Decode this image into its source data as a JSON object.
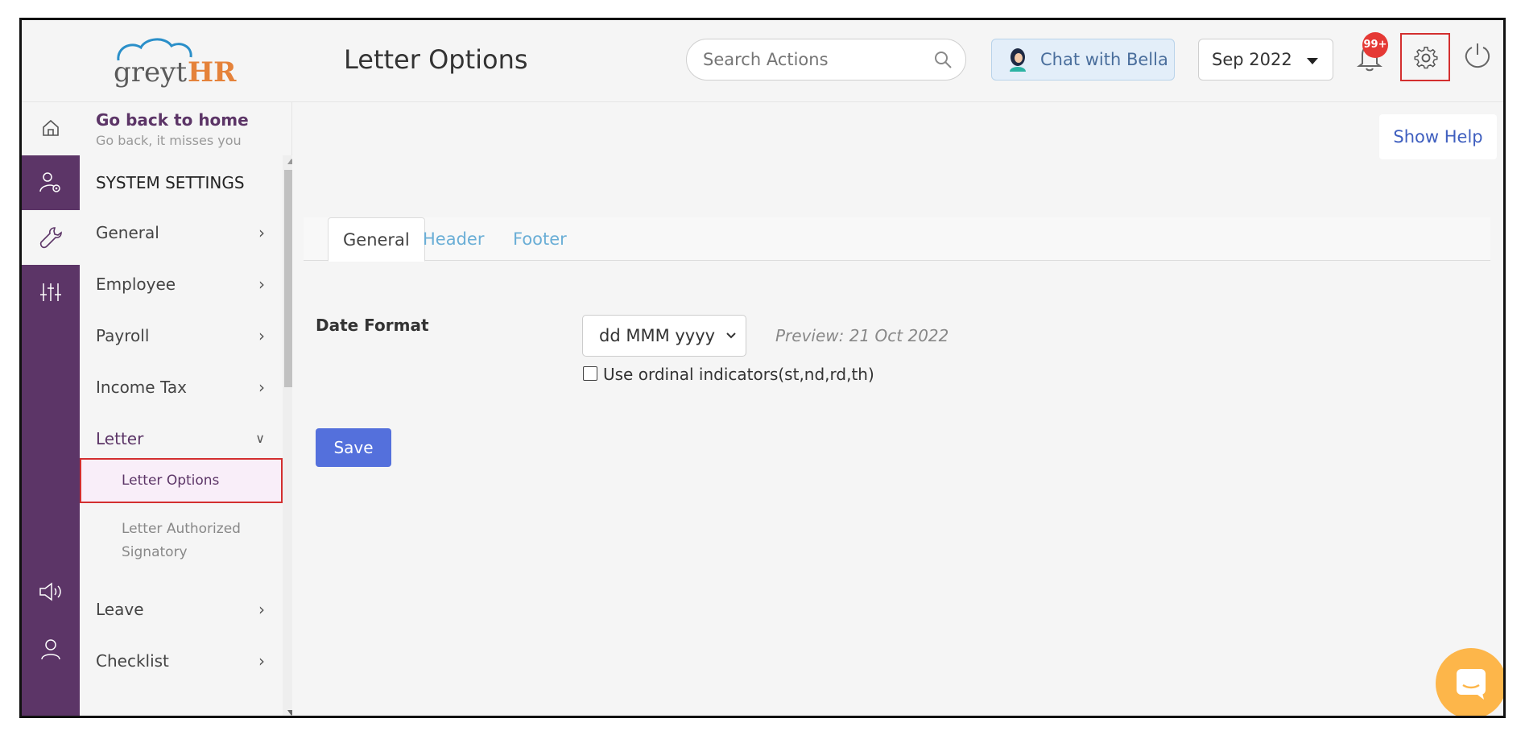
{
  "app": {
    "logo_text_1": "greyt",
    "logo_text_2": "HR",
    "page_title": "Letter Options"
  },
  "header": {
    "search_placeholder": "Search Actions",
    "chat_label": "Chat with Bella",
    "month_value": "Sep 2022",
    "notification_badge": "99+"
  },
  "sidebar": {
    "go_back_title": "Go back to home",
    "go_back_subtitle": "Go back, it misses you",
    "section_title": "SYSTEM SETTINGS",
    "items": [
      {
        "label": "General"
      },
      {
        "label": "Employee"
      },
      {
        "label": "Payroll"
      },
      {
        "label": "Income Tax"
      },
      {
        "label": "Letter"
      },
      {
        "label": "Leave"
      },
      {
        "label": "Checklist"
      }
    ],
    "letter_subitems": [
      {
        "label": "Letter Options"
      },
      {
        "label": "Letter Authorized Signatory"
      }
    ]
  },
  "main": {
    "show_help": "Show Help",
    "tabs": [
      {
        "label": "General"
      },
      {
        "label": "Header"
      },
      {
        "label": "Footer"
      }
    ],
    "date_format_label": "Date Format",
    "date_format_value": "dd MMM yyyy",
    "preview_text": "Preview: 21 Oct 2022",
    "ordinal_label": "Use ordinal indicators(st,nd,rd,th)",
    "ordinal_checked": false,
    "save_label": "Save"
  },
  "colors": {
    "brand_purple": "#5c3567",
    "accent_blue": "#5470dc",
    "logo_orange": "#e5823a",
    "badge_red": "#e53935",
    "fab_orange": "#fdb64a"
  }
}
